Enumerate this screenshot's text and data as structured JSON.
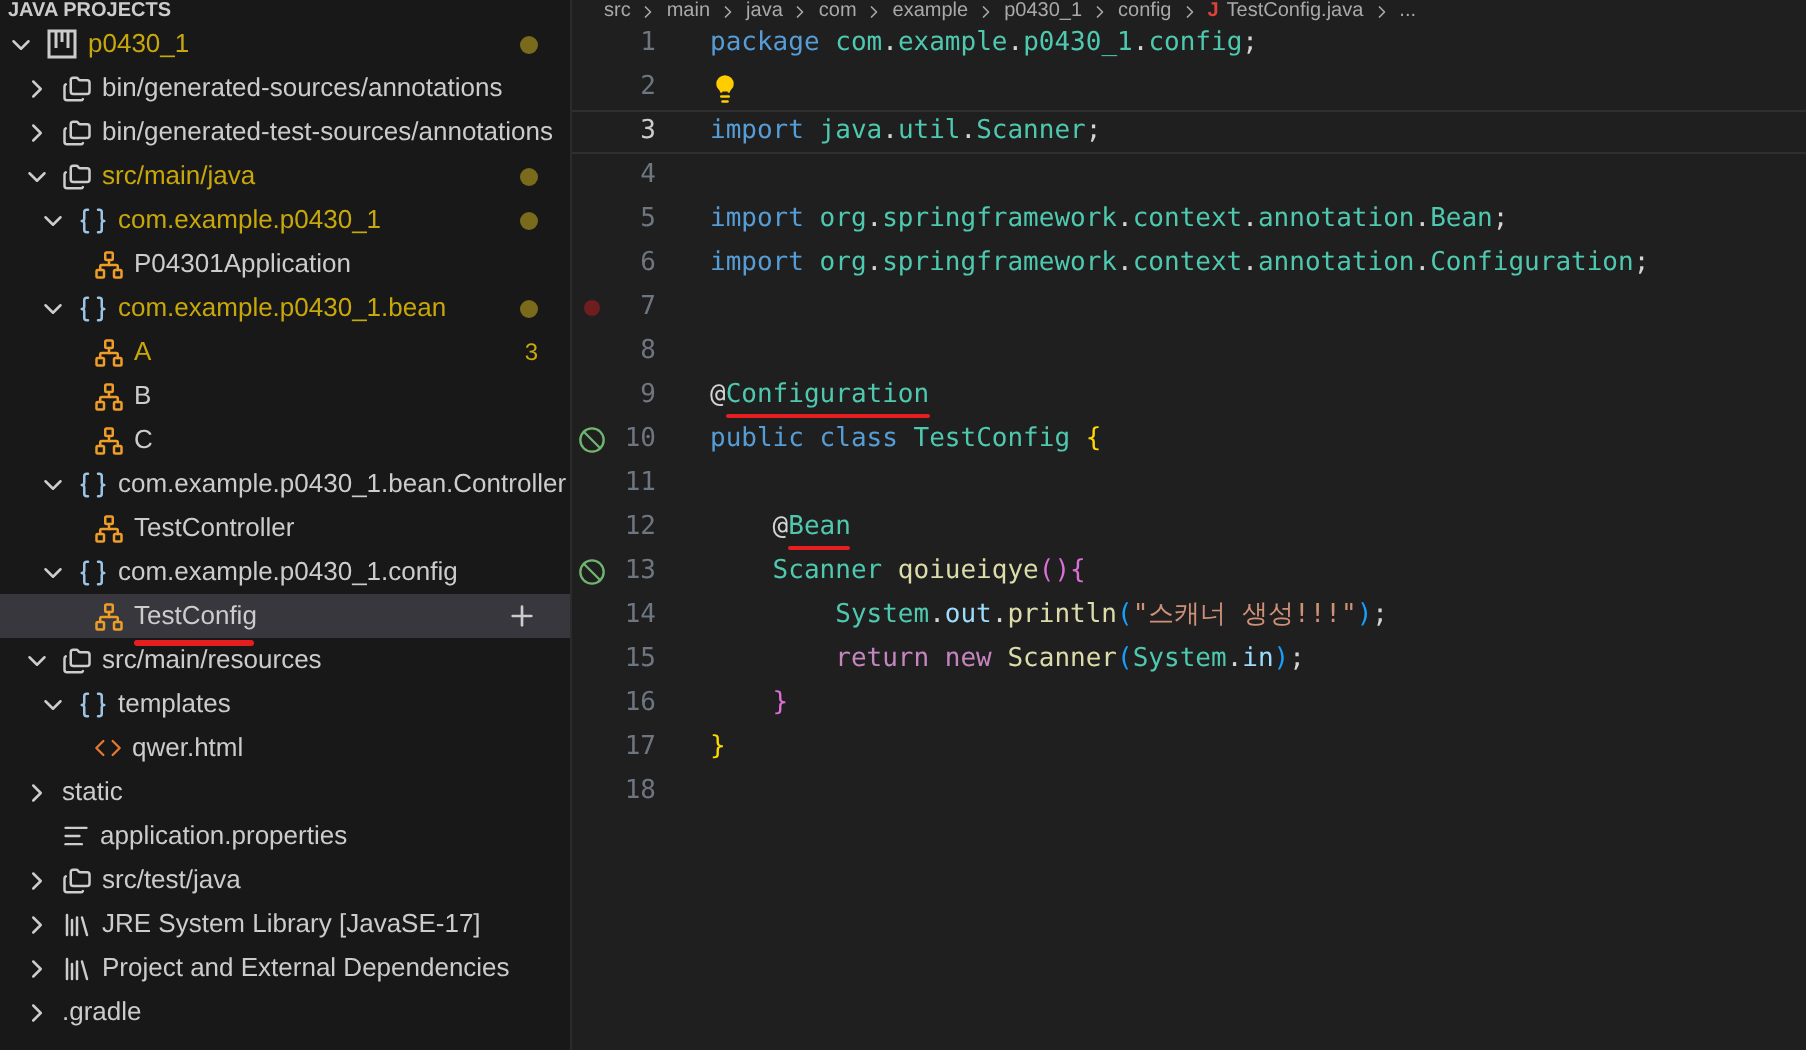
{
  "sidebar": {
    "title": "JAVA PROJECTS",
    "tree": [
      {
        "label": "p0430_1",
        "kind": "project",
        "expanded": true,
        "modified": true,
        "children": [
          {
            "label": "bin/generated-sources/annotations",
            "kind": "folder",
            "expanded": false
          },
          {
            "label": "bin/generated-test-sources/annotations",
            "kind": "folder",
            "expanded": false
          },
          {
            "label": "src/main/java",
            "kind": "folder",
            "expanded": true,
            "modified": true,
            "children": [
              {
                "label": "com.example.p0430_1",
                "kind": "package",
                "expanded": true,
                "modified": true,
                "children": [
                  {
                    "label": "P04301Application",
                    "kind": "class"
                  }
                ]
              },
              {
                "label": "com.example.p0430_1.bean",
                "kind": "package",
                "expanded": true,
                "modified": true,
                "children": [
                  {
                    "label": "A",
                    "kind": "class",
                    "modified": true,
                    "badge": "3"
                  },
                  {
                    "label": "B",
                    "kind": "class"
                  },
                  {
                    "label": "C",
                    "kind": "class"
                  }
                ]
              },
              {
                "label": "com.example.p0430_1.bean.Controller",
                "kind": "package",
                "expanded": true,
                "children": [
                  {
                    "label": "TestController",
                    "kind": "class"
                  }
                ]
              },
              {
                "label": "com.example.p0430_1.config",
                "kind": "package",
                "expanded": true,
                "children": [
                  {
                    "label": "TestConfig",
                    "kind": "class",
                    "selected": true,
                    "underlined": true
                  }
                ]
              }
            ]
          },
          {
            "label": "src/main/resources",
            "kind": "folder",
            "expanded": true,
            "children": [
              {
                "label": "templates",
                "kind": "package",
                "expanded": true,
                "children": [
                  {
                    "label": "qwer.html",
                    "kind": "html"
                  }
                ]
              }
            ]
          },
          {
            "label": "static",
            "kind": "plain",
            "expanded": false
          },
          {
            "label": "application.properties",
            "kind": "file"
          },
          {
            "label": "src/test/java",
            "kind": "folder",
            "expanded": false
          },
          {
            "label": "JRE System Library [JavaSE-17]",
            "kind": "library",
            "expanded": false
          },
          {
            "label": "Project and External Dependencies",
            "kind": "library",
            "expanded": false
          },
          {
            "label": ".gradle",
            "kind": "plain",
            "expanded": false
          }
        ]
      }
    ]
  },
  "editor": {
    "breadcrumb": [
      "src",
      "main",
      "java",
      "com",
      "example",
      "p0430_1",
      "config",
      "TestConfig.java",
      "..."
    ],
    "file_glyph": "J",
    "lines": [
      {
        "number": "1",
        "tokens": [
          {
            "text": "package ",
            "kind": "keyword"
          },
          {
            "text": "com",
            "kind": "type"
          },
          {
            "text": ".",
            "kind": "plain"
          },
          {
            "text": "example",
            "kind": "type"
          },
          {
            "text": ".",
            "kind": "plain"
          },
          {
            "text": "p0430_1",
            "kind": "type"
          },
          {
            "text": ".",
            "kind": "plain"
          },
          {
            "text": "config",
            "kind": "type"
          },
          {
            "text": ";",
            "kind": "plain"
          }
        ]
      },
      {
        "number": "2",
        "lightbulb": true
      },
      {
        "number": "3",
        "current": true,
        "tokens": [
          {
            "text": "import ",
            "kind": "keyword"
          },
          {
            "text": "java",
            "kind": "type"
          },
          {
            "text": ".",
            "kind": "plain"
          },
          {
            "text": "util",
            "kind": "type"
          },
          {
            "text": ".",
            "kind": "plain"
          },
          {
            "text": "Scanner",
            "kind": "type"
          },
          {
            "text": ";",
            "kind": "plain"
          }
        ]
      },
      {
        "number": "4"
      },
      {
        "number": "5",
        "tokens": [
          {
            "text": "import ",
            "kind": "keyword"
          },
          {
            "text": "org",
            "kind": "type"
          },
          {
            "text": ".",
            "kind": "plain"
          },
          {
            "text": "springframework",
            "kind": "type"
          },
          {
            "text": ".",
            "kind": "plain"
          },
          {
            "text": "context",
            "kind": "type"
          },
          {
            "text": ".",
            "kind": "plain"
          },
          {
            "text": "annotation",
            "kind": "type"
          },
          {
            "text": ".",
            "kind": "plain"
          },
          {
            "text": "Bean",
            "kind": "type"
          },
          {
            "text": ";",
            "kind": "plain"
          }
        ]
      },
      {
        "number": "6",
        "tokens": [
          {
            "text": "import ",
            "kind": "keyword"
          },
          {
            "text": "org",
            "kind": "type"
          },
          {
            "text": ".",
            "kind": "plain"
          },
          {
            "text": "springframework",
            "kind": "type"
          },
          {
            "text": ".",
            "kind": "plain"
          },
          {
            "text": "context",
            "kind": "type"
          },
          {
            "text": ".",
            "kind": "plain"
          },
          {
            "text": "annotation",
            "kind": "type"
          },
          {
            "text": ".",
            "kind": "plain"
          },
          {
            "text": "Configuration",
            "kind": "type"
          },
          {
            "text": ";",
            "kind": "plain"
          }
        ]
      },
      {
        "number": "7",
        "breakpoint": true
      },
      {
        "number": "8"
      },
      {
        "number": "9",
        "tokens": [
          {
            "text": "@",
            "kind": "plain"
          },
          {
            "text": "Configuration",
            "kind": "type",
            "underlined": true
          }
        ]
      },
      {
        "number": "10",
        "bean_marker": true,
        "tokens": [
          {
            "text": "public ",
            "kind": "keyword"
          },
          {
            "text": "class ",
            "kind": "keyword"
          },
          {
            "text": "TestConfig ",
            "kind": "type"
          },
          {
            "text": "{",
            "kind": "brace1"
          }
        ]
      },
      {
        "number": "11"
      },
      {
        "number": "12",
        "tokens": [
          {
            "text": "    @",
            "kind": "plain"
          },
          {
            "text": "Bean",
            "kind": "type",
            "underlined": true
          }
        ]
      },
      {
        "number": "13",
        "bean_marker": true,
        "tokens": [
          {
            "text": "    Scanner ",
            "kind": "type"
          },
          {
            "text": "qoiueiqye",
            "kind": "function"
          },
          {
            "text": "(){",
            "kind": "brace2"
          }
        ]
      },
      {
        "number": "14",
        "tokens": [
          {
            "text": "        System",
            "kind": "type"
          },
          {
            "text": ".",
            "kind": "plain"
          },
          {
            "text": "out",
            "kind": "variable"
          },
          {
            "text": ".",
            "kind": "plain"
          },
          {
            "text": "println",
            "kind": "function"
          },
          {
            "text": "(",
            "kind": "brace3"
          },
          {
            "text": "\"스캐너 생성!!!\"",
            "kind": "string"
          },
          {
            "text": ")",
            "kind": "brace3"
          },
          {
            "text": ";",
            "kind": "plain"
          }
        ]
      },
      {
        "number": "15",
        "tokens": [
          {
            "text": "        return ",
            "kind": "control"
          },
          {
            "text": "new ",
            "kind": "control"
          },
          {
            "text": "Scanner",
            "kind": "function"
          },
          {
            "text": "(",
            "kind": "brace3"
          },
          {
            "text": "System",
            "kind": "type"
          },
          {
            "text": ".",
            "kind": "plain"
          },
          {
            "text": "in",
            "kind": "variable"
          },
          {
            "text": ")",
            "kind": "brace3"
          },
          {
            "text": ";",
            "kind": "plain"
          }
        ]
      },
      {
        "number": "16",
        "tokens": [
          {
            "text": "    }",
            "kind": "brace2"
          }
        ]
      },
      {
        "number": "17",
        "tokens": [
          {
            "text": "}",
            "kind": "brace1"
          }
        ]
      },
      {
        "number": "18"
      }
    ]
  }
}
